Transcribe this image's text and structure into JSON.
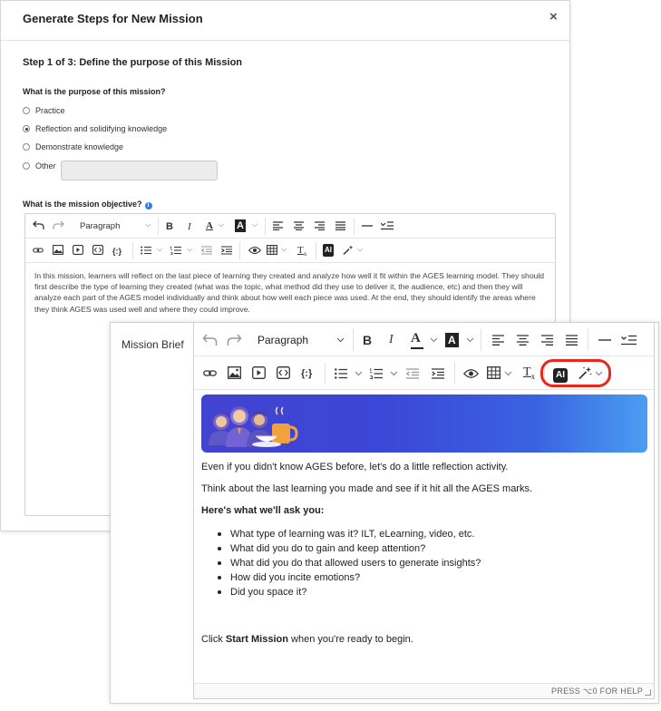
{
  "modal": {
    "title": "Generate Steps for New Mission",
    "close": "×",
    "step_title": "Step 1 of 3: Define the purpose of this Mission",
    "purpose_question": "What is the purpose of this mission?",
    "options": [
      "Practice",
      "Reflection and solidifying knowledge",
      "Demonstrate knowledge",
      "Other"
    ],
    "selected_option": "Reflection and solidifying knowledge",
    "other_value": "",
    "objective_label": "What is the mission objective?",
    "objective_text": "In this mission, learners will reflect on the last piece of learning they created and analyze how well it fit within the AGES learning model. They should first describe the type of learning they created (what was the topic, what method did they use to deliver it, the audience, etc) and then they will analyze each part of the AGES model individually and think about how well each piece was used. At the end, they should identify the areas where they think AGES was used well and where they could improve."
  },
  "toolbar": {
    "paragraph": "Paragraph",
    "bold": "B",
    "italic": "I",
    "font_color": "A",
    "highlight": "A",
    "code_block": "{:}",
    "ai": "AI",
    "clear_format": "T",
    "clear_sub": "x"
  },
  "brief": {
    "label": "Mission Brief",
    "p1": "Even if you didn't know AGES before, let's do a little reflection activity.",
    "p2": "Think about the last learning you made and see if it hit all the AGES marks.",
    "p3": "Here's what we'll ask you:",
    "bullets": [
      "What type of learning was it? ILT, eLearning, video, etc.",
      "What did you do to gain and keep attention?",
      "What did you do that allowed users to generate insights?",
      "How did you incite emotions?",
      "Did you space it?"
    ],
    "p4_pre": "Click ",
    "p4_bold": "Start Mission",
    "p4_post": " when you're ready to begin.",
    "help": "PRESS ⌥0 FOR HELP"
  },
  "colors": {
    "highlight_ring": "#e8281c",
    "banner_start": "#4343d0",
    "banner_end": "#4a9ef0",
    "info": "#3d7ddb"
  }
}
